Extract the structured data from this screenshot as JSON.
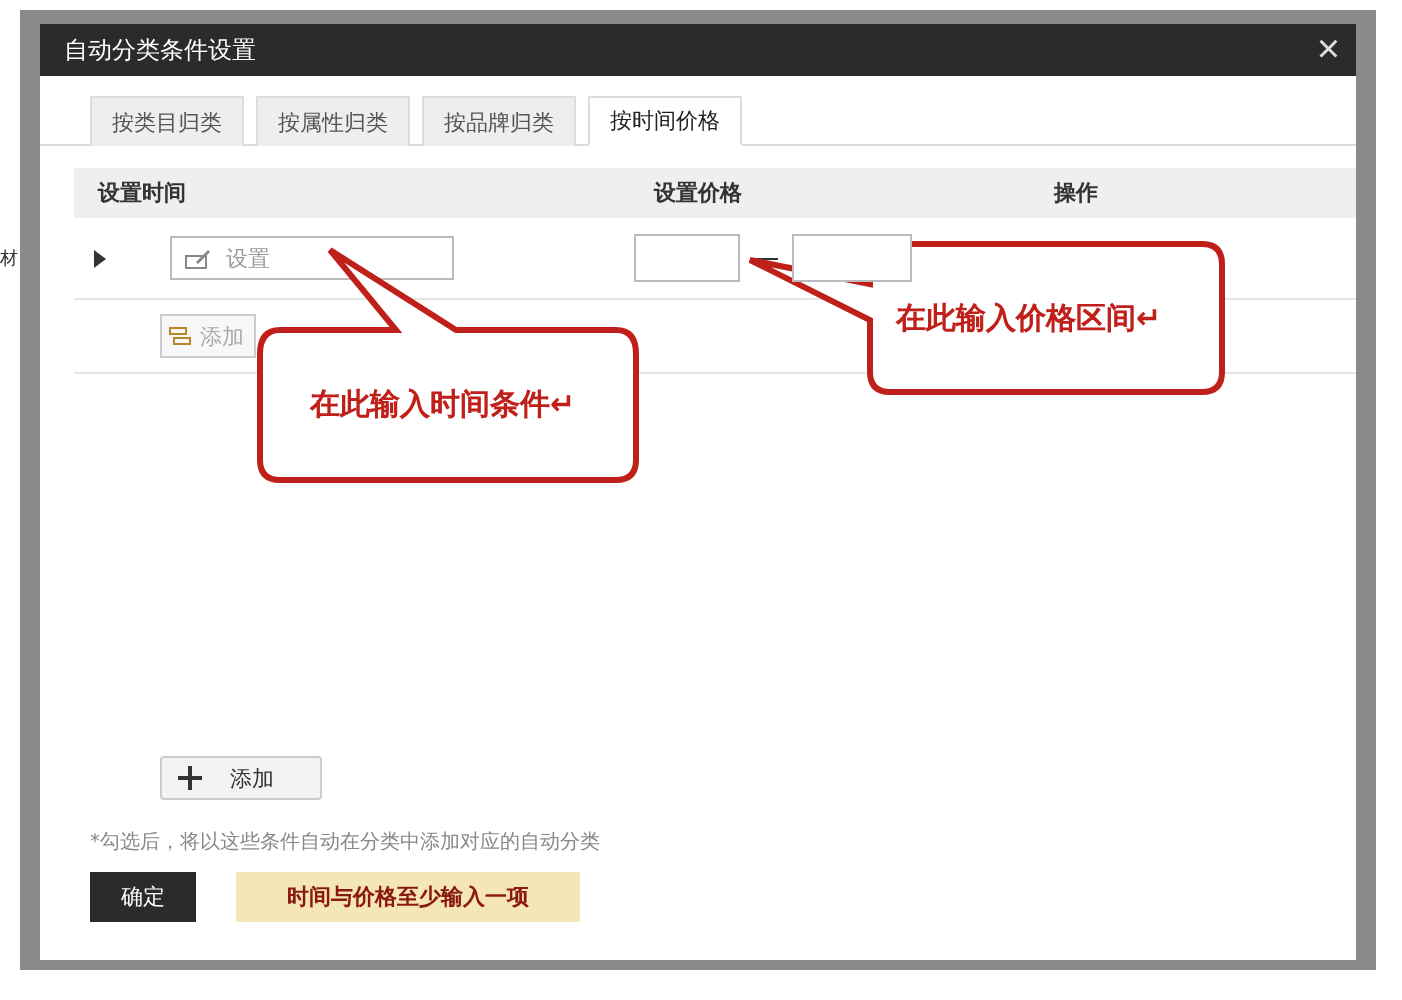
{
  "background": {
    "fragment": "材"
  },
  "dialog": {
    "title": "自动分类条件设置",
    "close": "×",
    "tabs": [
      {
        "label": "按类目归类",
        "selected": false
      },
      {
        "label": "按属性归类",
        "selected": false
      },
      {
        "label": "按品牌归类",
        "selected": false
      },
      {
        "label": "按时间价格",
        "selected": true
      }
    ],
    "table": {
      "columns": [
        "设置时间",
        "设置价格",
        "操作"
      ],
      "row": {
        "expanded": false,
        "time_placeholder": "设置",
        "add_label": "添加"
      }
    },
    "add_button": "添加",
    "note": "*勾选后，将以这些条件自动在分类中添加对应的自动分类",
    "confirm": "确定",
    "hint": "时间与价格至少输入一项"
  },
  "callouts": [
    {
      "text": "在此输入时间条件↵"
    },
    {
      "text": "在此输入价格区间↵"
    }
  ]
}
